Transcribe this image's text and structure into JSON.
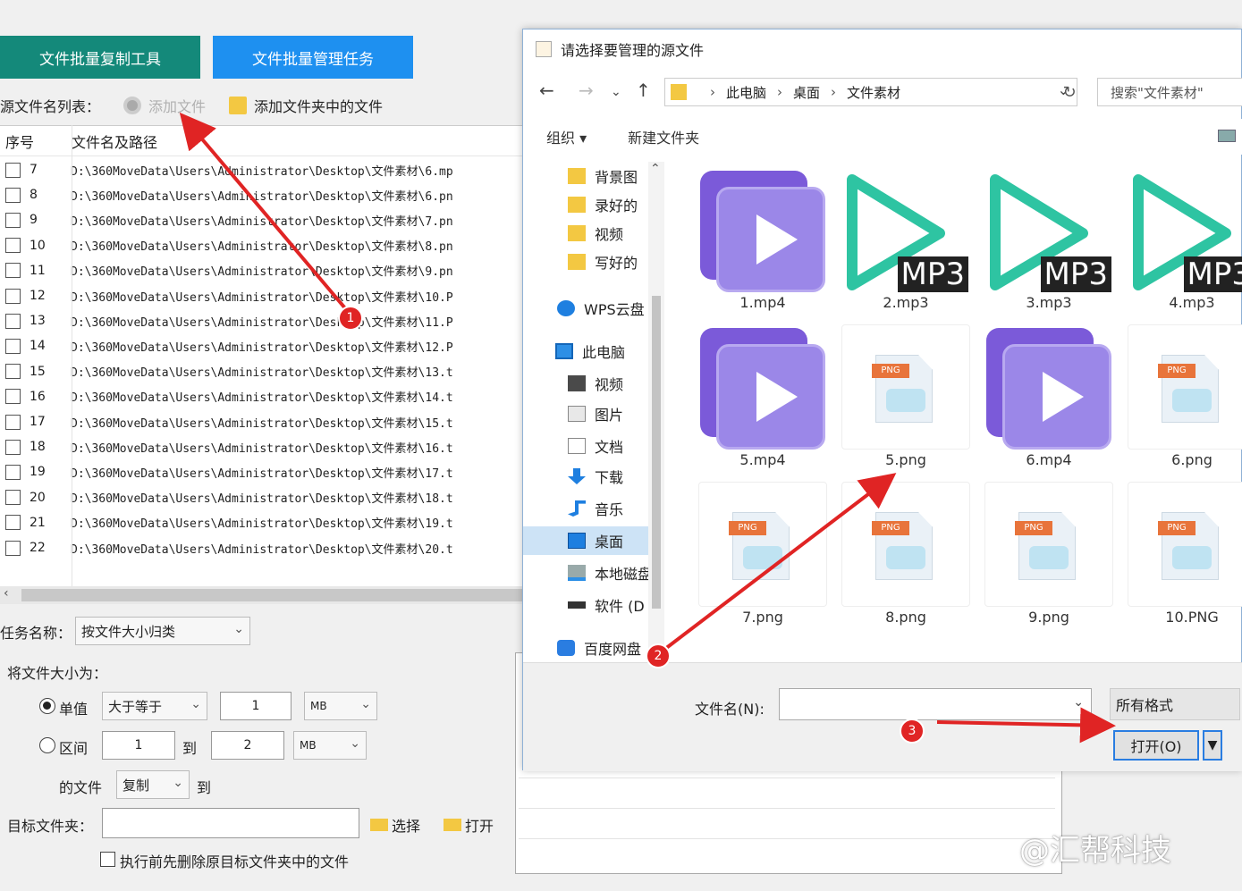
{
  "left": {
    "tab_copy": "文件批量复制工具",
    "tab_manage": "文件批量管理任务",
    "src_label": "源文件名列表：",
    "add_file": "添加文件",
    "add_folder_files": "添加文件夹中的文件",
    "col_seq": "序号",
    "col_path": "文件名及路径",
    "rows": [
      {
        "n": "7",
        "path": "D:\\360MoveData\\Users\\Administrator\\Desktop\\文件素材\\6.mp"
      },
      {
        "n": "8",
        "path": "D:\\360MoveData\\Users\\Administrator\\Desktop\\文件素材\\6.pn"
      },
      {
        "n": "9",
        "path": "D:\\360MoveData\\Users\\Administrator\\Desktop\\文件素材\\7.pn"
      },
      {
        "n": "10",
        "path": "D:\\360MoveData\\Users\\Administrator\\Desktop\\文件素材\\8.pn"
      },
      {
        "n": "11",
        "path": "D:\\360MoveData\\Users\\Administrator\\Desktop\\文件素材\\9.pn"
      },
      {
        "n": "12",
        "path": "D:\\360MoveData\\Users\\Administrator\\Desktop\\文件素材\\10.P"
      },
      {
        "n": "13",
        "path": "D:\\360MoveData\\Users\\Administrator\\Desktop\\文件素材\\11.P"
      },
      {
        "n": "14",
        "path": "D:\\360MoveData\\Users\\Administrator\\Desktop\\文件素材\\12.P"
      },
      {
        "n": "15",
        "path": "D:\\360MoveData\\Users\\Administrator\\Desktop\\文件素材\\13.t"
      },
      {
        "n": "16",
        "path": "D:\\360MoveData\\Users\\Administrator\\Desktop\\文件素材\\14.t"
      },
      {
        "n": "17",
        "path": "D:\\360MoveData\\Users\\Administrator\\Desktop\\文件素材\\15.t"
      },
      {
        "n": "18",
        "path": "D:\\360MoveData\\Users\\Administrator\\Desktop\\文件素材\\16.t"
      },
      {
        "n": "19",
        "path": "D:\\360MoveData\\Users\\Administrator\\Desktop\\文件素材\\17.t"
      },
      {
        "n": "20",
        "path": "D:\\360MoveData\\Users\\Administrator\\Desktop\\文件素材\\18.t"
      },
      {
        "n": "21",
        "path": "D:\\360MoveData\\Users\\Administrator\\Desktop\\文件素材\\19.t"
      },
      {
        "n": "22",
        "path": "D:\\360MoveData\\Users\\Administrator\\Desktop\\文件素材\\20.t"
      }
    ],
    "task_label": "任务名称：",
    "task_value": "按文件大小归类",
    "size_label": "将文件大小为：",
    "single_label": "单值",
    "single_op": "大于等于",
    "single_val": "1",
    "single_unit": "MB",
    "range_label": "区间",
    "range_from": "1",
    "range_to_word": "到",
    "range_to": "2",
    "range_unit": "MB",
    "files_label": "的文件",
    "action": "复制",
    "to_word": "到",
    "target_label": "目标文件夹：",
    "target_value": "",
    "choose": "选择",
    "open": "打开",
    "delete_before": "执行前先删除原目标文件夹中的文件"
  },
  "dialog": {
    "title": "请选择要管理的源文件",
    "crumb_pc": "此电脑",
    "crumb_desktop": "桌面",
    "crumb_folder": "文件素材",
    "search_placeholder": "搜索\"文件素材\"",
    "organize": "组织 ▾",
    "new_folder": "新建文件夹",
    "nav": [
      "背景图",
      "录好的",
      "视频",
      "写好的",
      "WPS云盘",
      "此电脑",
      "视频",
      "图片",
      "文档",
      "下载",
      "音乐",
      "桌面",
      "本地磁盘",
      "软件 (D",
      "百度网盘"
    ],
    "files": [
      {
        "name": "1.mp4",
        "kind": "mp4"
      },
      {
        "name": "2.mp3",
        "kind": "mp3"
      },
      {
        "name": "3.mp3",
        "kind": "mp3"
      },
      {
        "name": "4.mp3",
        "kind": "mp3"
      },
      {
        "name": "5.mp4",
        "kind": "mp4"
      },
      {
        "name": "5.png",
        "kind": "png"
      },
      {
        "name": "6.mp4",
        "kind": "mp4"
      },
      {
        "name": "6.png",
        "kind": "png"
      },
      {
        "name": "7.png",
        "kind": "png"
      },
      {
        "name": "8.png",
        "kind": "png"
      },
      {
        "name": "9.png",
        "kind": "png"
      },
      {
        "name": "10.PNG",
        "kind": "png"
      }
    ],
    "mp3_badge": "MP3",
    "png_tag": "PNG",
    "filename_label": "文件名(N):",
    "filename_value": "",
    "filter": "所有格式",
    "open_btn": "打开(O)"
  },
  "annotations": {
    "b1": "1",
    "b2": "2",
    "b3": "3",
    "color": "#e02424"
  },
  "watermark": "@汇帮科技"
}
